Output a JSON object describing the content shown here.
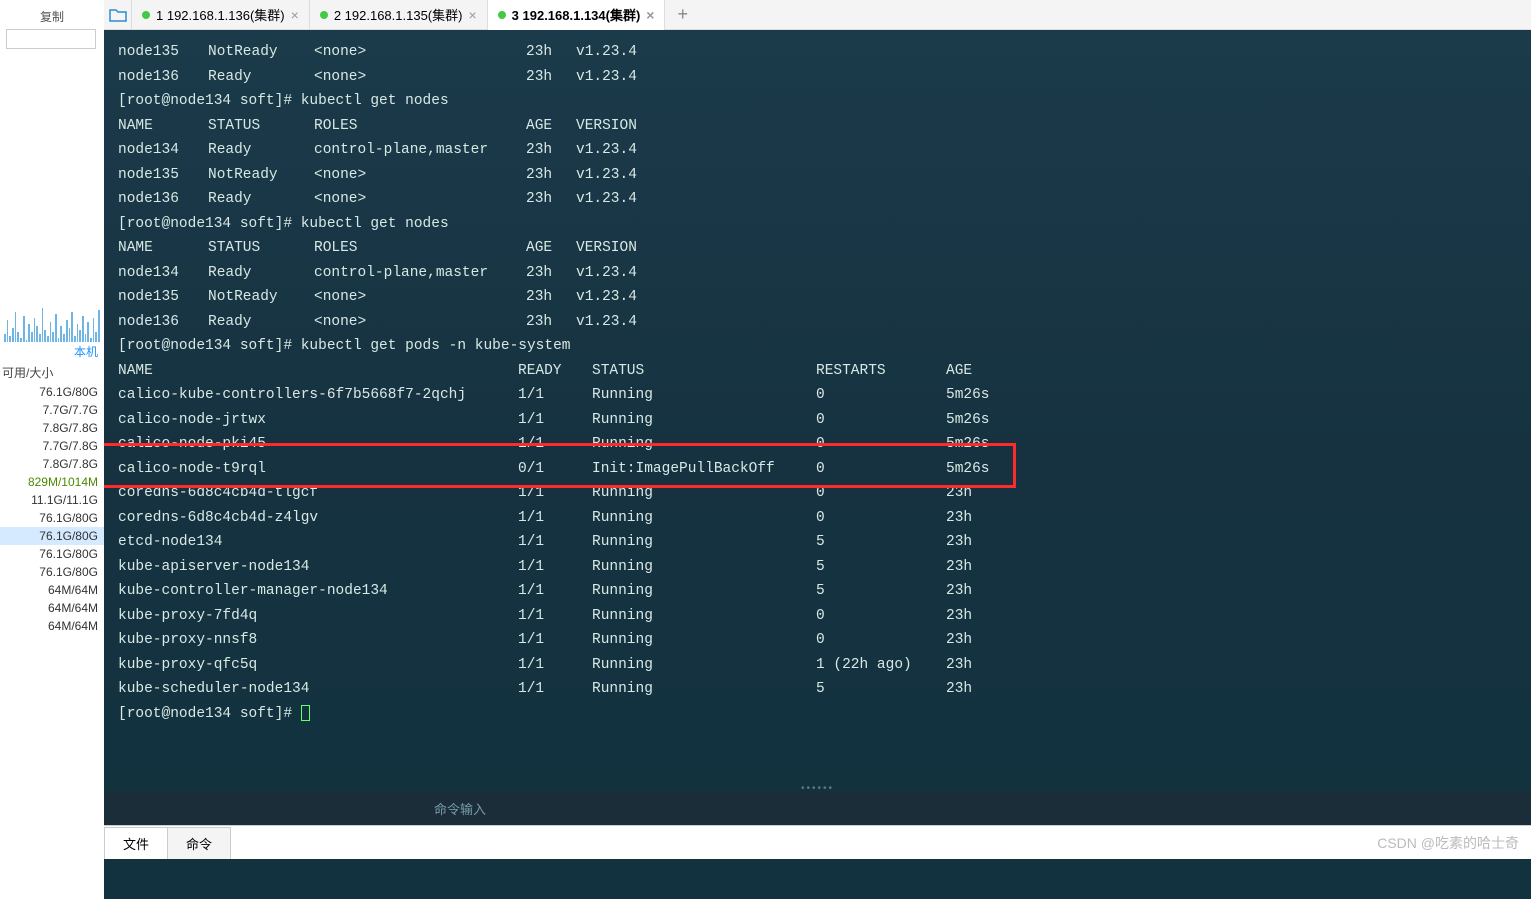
{
  "sidebar": {
    "copy": "复制",
    "local": "本机",
    "header": "可用/大小",
    "sizes": [
      "76.1G/80G",
      "7.7G/7.7G",
      "7.8G/7.8G",
      "7.7G/7.8G",
      "7.8G/7.8G",
      "829M/1014M",
      "11.1G/11.1G",
      "76.1G/80G",
      "76.1G/80G",
      "76.1G/80G",
      "76.1G/80G",
      "64M/64M",
      "64M/64M",
      "64M/64M"
    ],
    "selected_index": 8
  },
  "tabs": {
    "items": [
      {
        "num": "1",
        "title": "192.168.1.136(集群)"
      },
      {
        "num": "2",
        "title": "192.168.1.135(集群)"
      },
      {
        "num": "3",
        "title": "192.168.1.134(集群)"
      }
    ],
    "active": 2,
    "add": "+"
  },
  "terminal": {
    "prompt": "[root@node134 soft]#",
    "cmds": {
      "getnodes": "kubectl get nodes",
      "getpods": "kubectl get pods -n kube-system"
    },
    "nodes_header": {
      "name": "NAME",
      "status": "STATUS",
      "roles": "ROLES",
      "age": "AGE",
      "version": "VERSION"
    },
    "nodes_pre": [
      {
        "name": "node135",
        "status": "NotReady",
        "roles": "<none>",
        "age": "23h",
        "version": "v1.23.4"
      },
      {
        "name": "node136",
        "status": "Ready",
        "roles": "<none>",
        "age": "23h",
        "version": "v1.23.4"
      }
    ],
    "nodes1": [
      {
        "name": "node134",
        "status": "Ready",
        "roles": "control-plane,master",
        "age": "23h",
        "version": "v1.23.4"
      },
      {
        "name": "node135",
        "status": "NotReady",
        "roles": "<none>",
        "age": "23h",
        "version": "v1.23.4"
      },
      {
        "name": "node136",
        "status": "Ready",
        "roles": "<none>",
        "age": "23h",
        "version": "v1.23.4"
      }
    ],
    "nodes2": [
      {
        "name": "node134",
        "status": "Ready",
        "roles": "control-plane,master",
        "age": "23h",
        "version": "v1.23.4"
      },
      {
        "name": "node135",
        "status": "NotReady",
        "roles": "<none>",
        "age": "23h",
        "version": "v1.23.4"
      },
      {
        "name": "node136",
        "status": "Ready",
        "roles": "<none>",
        "age": "23h",
        "version": "v1.23.4"
      }
    ],
    "pods_header": {
      "name": "NAME",
      "ready": "READY",
      "status": "STATUS",
      "restarts": "RESTARTS",
      "age": "AGE"
    },
    "pods": [
      {
        "name": "calico-kube-controllers-6f7b5668f7-2qchj",
        "ready": "1/1",
        "status": "Running",
        "restarts": "0",
        "age": "5m26s"
      },
      {
        "name": "calico-node-jrtwx",
        "ready": "1/1",
        "status": "Running",
        "restarts": "0",
        "age": "5m26s"
      },
      {
        "name": "calico-node-pki45",
        "ready": "1/1",
        "status": "Running",
        "restarts": "0",
        "age": "5m26s"
      },
      {
        "name": "calico-node-t9rql",
        "ready": "0/1",
        "status": "Init:ImagePullBackOff",
        "restarts": "0",
        "age": "5m26s"
      },
      {
        "name": "coredns-6d8c4cb4d-tlgcf",
        "ready": "1/1",
        "status": "Running",
        "restarts": "0",
        "age": "23h"
      },
      {
        "name": "coredns-6d8c4cb4d-z4lgv",
        "ready": "1/1",
        "status": "Running",
        "restarts": "0",
        "age": "23h"
      },
      {
        "name": "etcd-node134",
        "ready": "1/1",
        "status": "Running",
        "restarts": "5",
        "age": "23h"
      },
      {
        "name": "kube-apiserver-node134",
        "ready": "1/1",
        "status": "Running",
        "restarts": "5",
        "age": "23h"
      },
      {
        "name": "kube-controller-manager-node134",
        "ready": "1/1",
        "status": "Running",
        "restarts": "5",
        "age": "23h"
      },
      {
        "name": "kube-proxy-7fd4q",
        "ready": "1/1",
        "status": "Running",
        "restarts": "0",
        "age": "23h"
      },
      {
        "name": "kube-proxy-nnsf8",
        "ready": "1/1",
        "status": "Running",
        "restarts": "0",
        "age": "23h"
      },
      {
        "name": "kube-proxy-qfc5q",
        "ready": "1/1",
        "status": "Running",
        "restarts": "1 (22h ago)",
        "age": "23h"
      },
      {
        "name": "kube-scheduler-node134",
        "ready": "1/1",
        "status": "Running",
        "restarts": "5",
        "age": "23h"
      }
    ]
  },
  "cmd_input": {
    "placeholder": "命令输入"
  },
  "bottom_tabs": {
    "file": "文件",
    "cmd": "命令"
  },
  "watermark": "CSDN @吃素的哈士奇"
}
